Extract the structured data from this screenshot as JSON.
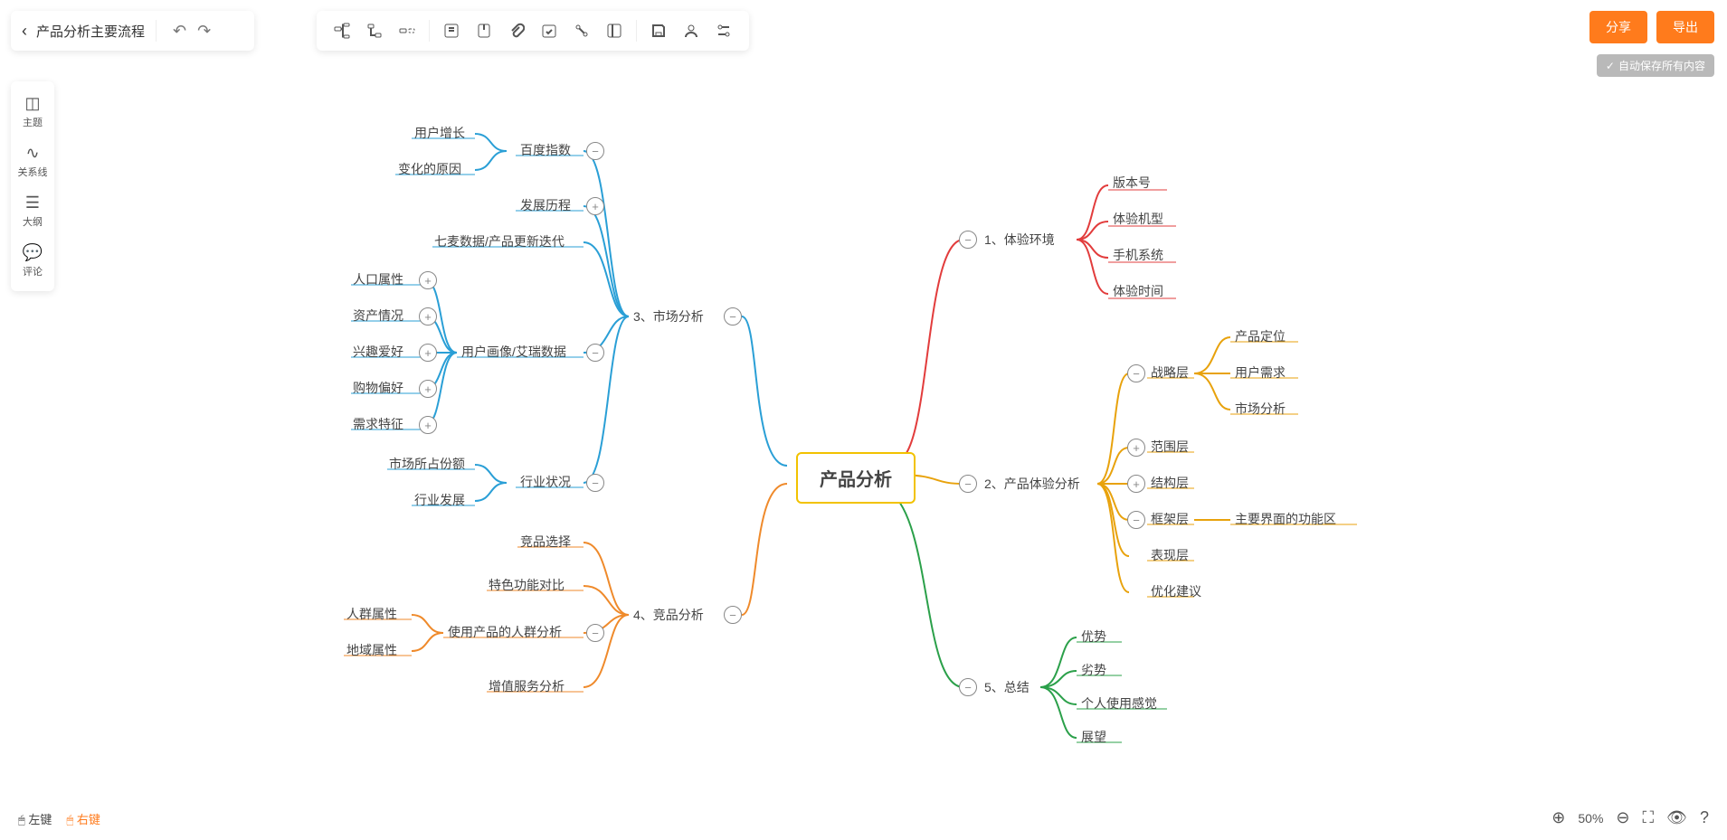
{
  "doc_title": "产品分析主要流程",
  "buttons": {
    "share": "分享",
    "export": "导出"
  },
  "autosave": "自动保存所有内容",
  "sidebar": {
    "theme": "主题",
    "relation": "关系线",
    "outline": "大纲",
    "comment": "评论"
  },
  "footer": {
    "left": "左键",
    "right": "右键",
    "zoom": "50%"
  },
  "mindmap": {
    "central": "产品分析",
    "branches": [
      {
        "id": "b1",
        "label": "1、体验环境",
        "color": "#e23c3c",
        "children": [
          {
            "label": "版本号"
          },
          {
            "label": "体验机型"
          },
          {
            "label": "手机系统"
          },
          {
            "label": "体验时间"
          }
        ]
      },
      {
        "id": "b2",
        "label": "2、产品体验分析",
        "color": "#e8a20c",
        "children": [
          {
            "label": "战略层",
            "toggle": "-",
            "children": [
              {
                "label": "产品定位"
              },
              {
                "label": "用户需求"
              },
              {
                "label": "市场分析"
              }
            ]
          },
          {
            "label": "范围层",
            "toggle": "+"
          },
          {
            "label": "结构层",
            "toggle": "+"
          },
          {
            "label": "框架层",
            "toggle": "-",
            "children": [
              {
                "label": "主要界面的功能区"
              }
            ]
          },
          {
            "label": "表现层"
          },
          {
            "label": "优化建议"
          }
        ]
      },
      {
        "id": "b5",
        "label": "5、总结",
        "color": "#2ba04a",
        "children": [
          {
            "label": "优势"
          },
          {
            "label": "劣势"
          },
          {
            "label": "个人使用感觉"
          },
          {
            "label": "展望"
          }
        ]
      },
      {
        "id": "b3",
        "label": "3、市场分析",
        "color": "#2a9fd6",
        "children": [
          {
            "label": "百度指数",
            "toggle": "-",
            "children": [
              {
                "label": "用户增长"
              },
              {
                "label": "变化的原因"
              }
            ]
          },
          {
            "label": "发展历程",
            "toggle": "+"
          },
          {
            "label": "七麦数据/产品更新迭代"
          },
          {
            "label": "用户画像/艾瑞数据",
            "toggle": "-",
            "children": [
              {
                "label": "人口属性",
                "toggle": "+"
              },
              {
                "label": "资产情况",
                "toggle": "+"
              },
              {
                "label": "兴趣爱好",
                "toggle": "+"
              },
              {
                "label": "购物偏好",
                "toggle": "+"
              },
              {
                "label": "需求特征",
                "toggle": "+"
              }
            ]
          },
          {
            "label": "行业状况",
            "toggle": "-",
            "children": [
              {
                "label": "市场所占份额"
              },
              {
                "label": "行业发展"
              }
            ]
          }
        ]
      },
      {
        "id": "b4",
        "label": "4、竞品分析",
        "color": "#ef8a2b",
        "children": [
          {
            "label": "竞品选择"
          },
          {
            "label": "特色功能对比"
          },
          {
            "label": "使用产品的人群分析",
            "toggle": "-",
            "children": [
              {
                "label": "人群属性"
              },
              {
                "label": "地域属性"
              }
            ]
          },
          {
            "label": "增值服务分析"
          }
        ]
      }
    ]
  }
}
